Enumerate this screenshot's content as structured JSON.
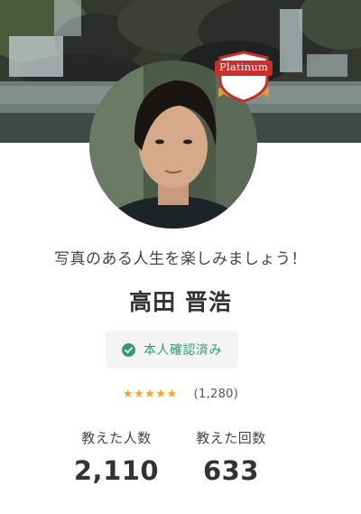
{
  "profile": {
    "badge_label": "Platinum",
    "tagline": "写真のある人生を楽しみましょう！",
    "name": "高田 晋浩",
    "verified_label": "本人確認済み",
    "rating_stars": "★★★★★",
    "rating_value": 5,
    "review_count": "(1,280)",
    "stats": {
      "students_label": "教えた人数",
      "students_value": "2,110",
      "lessons_label": "教えた回数",
      "lessons_value": "633"
    }
  },
  "icons": {
    "verified": "check-circle-icon",
    "badge": "platinum-badge-icon"
  },
  "colors": {
    "verified_green": "#2f9e6b",
    "star_gold": "#f6a623",
    "badge_red": "#c9302c"
  }
}
